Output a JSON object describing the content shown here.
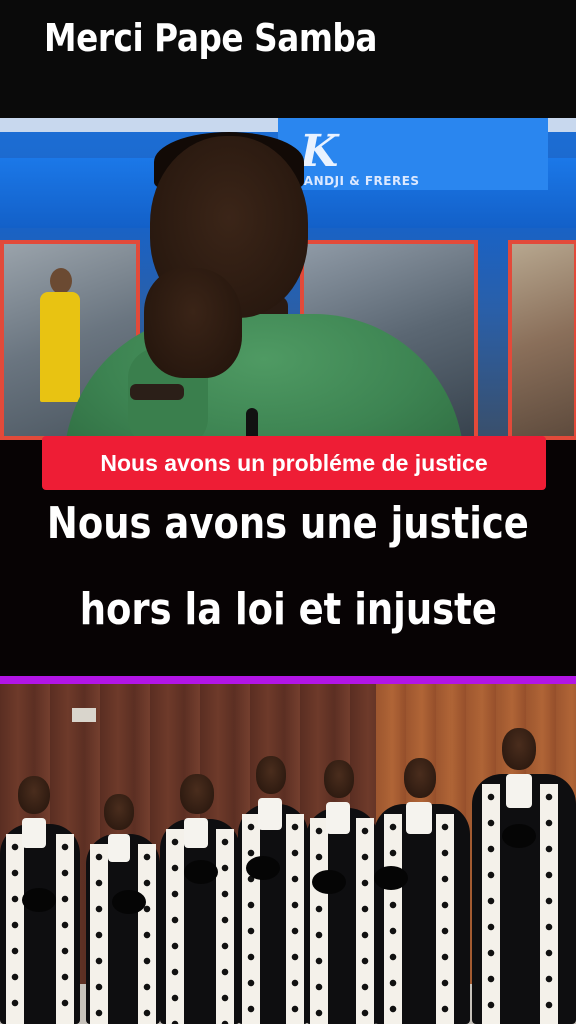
{
  "header": {
    "title": "Merci Pape Samba"
  },
  "studio": {
    "logo_mark": "K",
    "logo_text": "KANDJI & FRERES"
  },
  "captions": {
    "label": "Nous avons un probléme de justice",
    "line1": "Nous avons une justice",
    "line2": "hors la loi et injuste"
  },
  "colors": {
    "label_bg": "#ee1d35",
    "divider": "#b215e6",
    "studio_blue": "#1b78e8"
  }
}
